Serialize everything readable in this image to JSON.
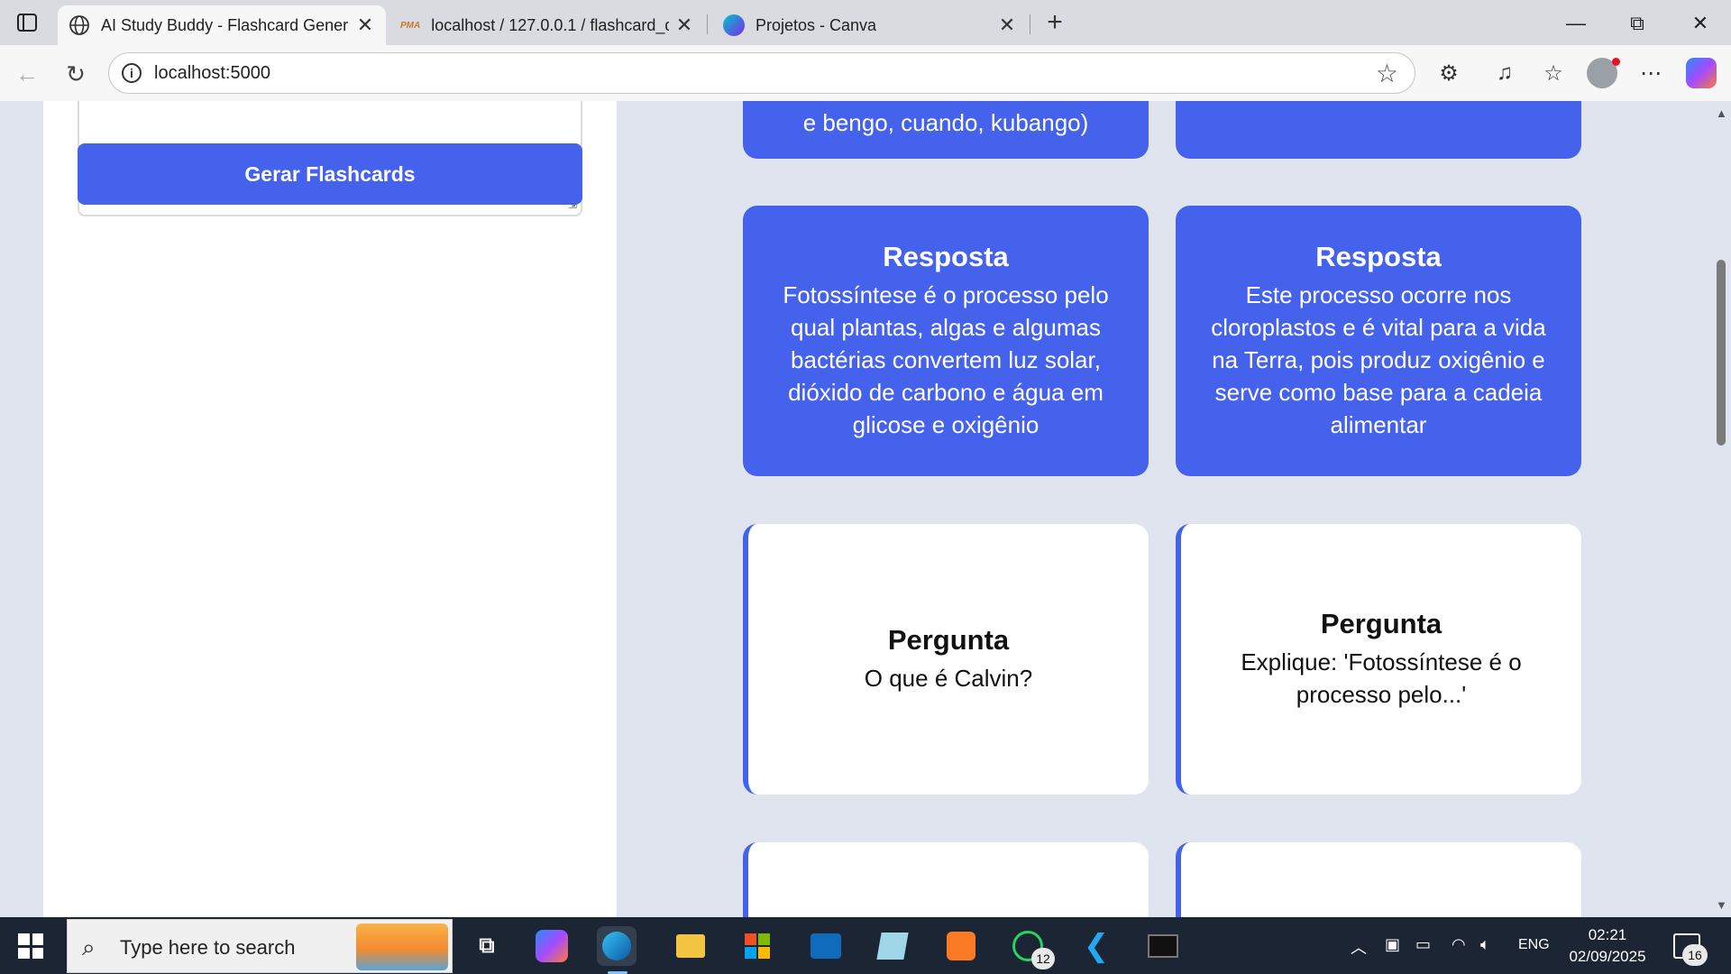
{
  "browser": {
    "tabs": [
      {
        "title": "AI Study Buddy - Flashcard Gener",
        "active": true,
        "icon": "globe-icon"
      },
      {
        "title": "localhost / 127.0.0.1 / flashcard_d",
        "active": false,
        "icon": "phpmyadmin-icon"
      },
      {
        "title": "Projetos - Canva",
        "active": false,
        "icon": "canva-icon"
      }
    ],
    "new_tab": "+",
    "window": {
      "minimize": "—",
      "restore": "⧉",
      "close": "✕"
    },
    "url": "localhost:5000",
    "info_glyph": "i"
  },
  "left_panel": {
    "generate_button": "Gerar Flashcards"
  },
  "cards": [
    {
      "type": "answer",
      "head": "",
      "body": "e bengo, cuando, kubango)"
    },
    {
      "type": "answer",
      "head": "",
      "body": ""
    },
    {
      "type": "answer",
      "head": "Resposta",
      "body": "Fotossíntese é o processo pelo qual plantas, algas e algumas bactérias convertem luz solar, dióxido de carbono e água em glicose e oxigênio"
    },
    {
      "type": "answer",
      "head": "Resposta",
      "body": "Este processo ocorre nos cloroplastos e é vital para a vida na Terra, pois produz oxigênio e serve como base para a cadeia alimentar"
    },
    {
      "type": "question",
      "head": "Pergunta",
      "body": "O que é Calvin?"
    },
    {
      "type": "question",
      "head": "Pergunta",
      "body": "Explique: 'Fotossíntese é o processo pelo...'"
    }
  ],
  "taskbar": {
    "search_placeholder": "Type here to search",
    "whatsapp_badge": "12",
    "language": "ENG",
    "time": "02:21",
    "date": "02/09/2025",
    "notifications": "16"
  },
  "colors": {
    "accent": "#4562ec",
    "page_bg": "#dfe4ee",
    "taskbar": "#1c2533"
  }
}
